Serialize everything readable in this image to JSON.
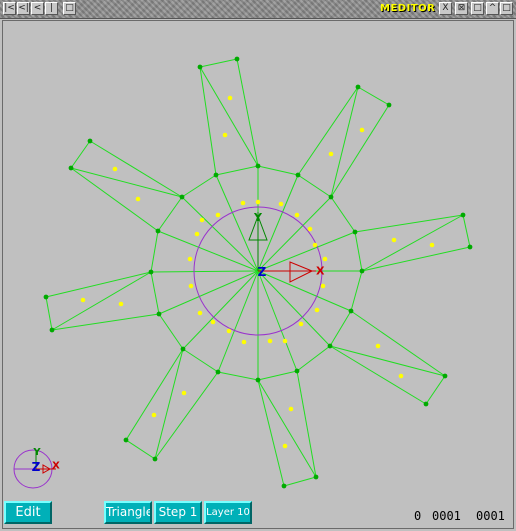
{
  "window": {
    "title": "MEDITOR",
    "left_buttons": [
      "|<",
      "<|",
      "<",
      "|",
      "□"
    ],
    "right_buttons": [
      "X",
      "⊠",
      "□",
      "^",
      "□"
    ]
  },
  "viewport": {
    "mesh_color": "#22dd22",
    "vertex_color": "#00aa00",
    "centroid_color": "#ffff00",
    "circle_color": "#9933cc",
    "axis_y_color": "#008800",
    "axis_x_color": "#cc0000",
    "axis_z_color": "#0000cc",
    "axis_labels": {
      "x": "X",
      "y": "Y",
      "z": "Z"
    }
  },
  "toolbar": {
    "edit_label": "Edit",
    "triangle_label": "Triangle",
    "step_label": "Step 1",
    "layer_label": "Layer 10"
  },
  "status": {
    "value_a": "0",
    "value_b": "0001",
    "value_c": "0001"
  }
}
